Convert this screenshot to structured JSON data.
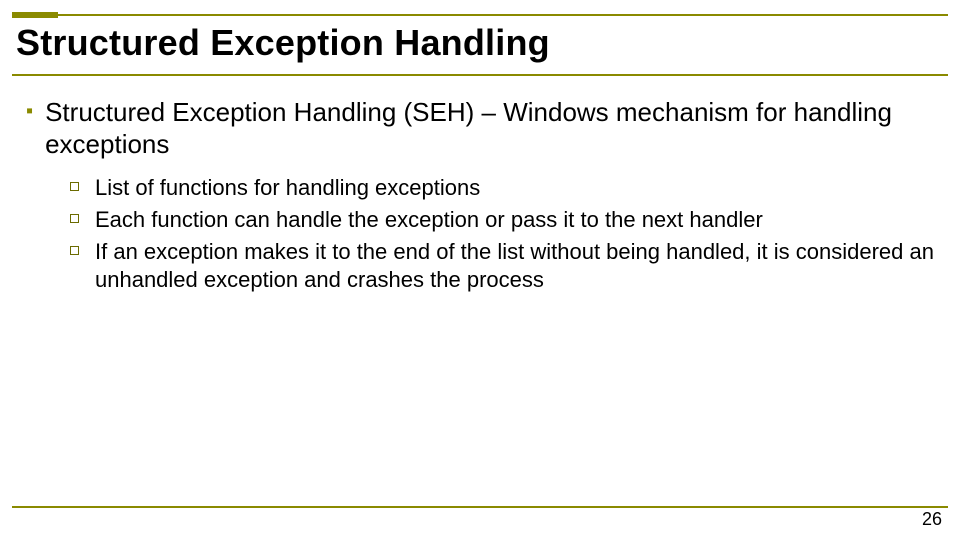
{
  "title": "Structured Exception Handling",
  "main_point": "Structured Exception Handling (SEH) – Windows mechanism for handling exceptions",
  "sub_points": [
    "List of functions for handling exceptions",
    "Each function can handle the exception or pass it to the next handler",
    "If an exception makes it to the end of the list without being handled, it is considered an unhandled exception and crashes the process"
  ],
  "page_number": "26"
}
